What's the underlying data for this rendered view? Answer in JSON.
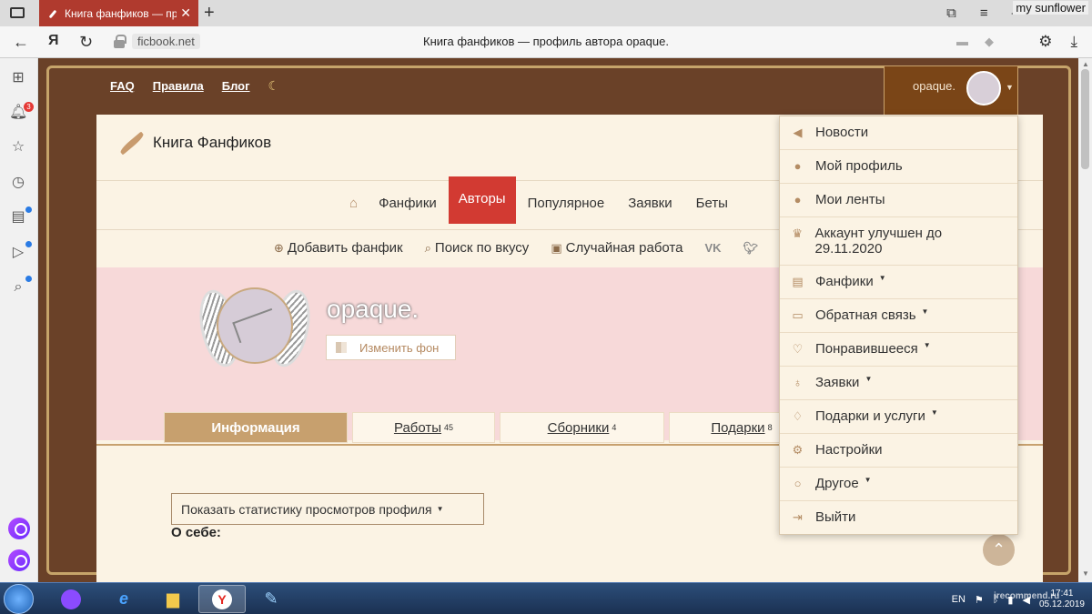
{
  "browser": {
    "tab_title": "Книга фанфиков — про",
    "url": "ficbook.net",
    "page_title": "Книга фанфиков — профиль автора opaque.",
    "yandex_logo": "Я",
    "watermark_user": "my sunflower",
    "notification_count": "3"
  },
  "site": {
    "top_links": [
      "FAQ",
      "Правила",
      "Блог"
    ],
    "username": "opaque.",
    "logo_text": "Книга Фанфиков",
    "main_nav": [
      "Фанфики",
      "Авторы",
      "Популярное",
      "Заявки",
      "Беты"
    ],
    "actions": [
      "Добавить фанфик",
      "Поиск по вкусу",
      "Случайная работа"
    ],
    "social": [
      "VK",
      "TW"
    ],
    "profile_name": "opaque.",
    "change_bg": "Изменить фон",
    "tabs": [
      {
        "label": "Информация",
        "count": ""
      },
      {
        "label": "Работы",
        "count": "45"
      },
      {
        "label": "Сборники",
        "count": "4"
      },
      {
        "label": "Подарки",
        "count": "8"
      }
    ],
    "stats_button": "Показать статистику просмотров профиля",
    "about_heading": "О себе:"
  },
  "dropdown": {
    "items": [
      {
        "label": "Новости",
        "icon": "megaphone-icon"
      },
      {
        "label": "Мой профиль",
        "icon": "user-icon"
      },
      {
        "label": "Мои ленты",
        "icon": "user-icon"
      },
      {
        "label": "Аккаунт улучшен до 29.11.2020",
        "icon": "crown-icon"
      },
      {
        "label": "Фанфики",
        "icon": "book-icon",
        "caret": true
      },
      {
        "label": "Обратная связь",
        "icon": "chat-icon",
        "caret": true
      },
      {
        "label": "Понравившееся",
        "icon": "heart-icon",
        "caret": true
      },
      {
        "label": "Заявки",
        "icon": "bulb-icon",
        "caret": true
      },
      {
        "label": "Подарки и услуги",
        "icon": "gift-icon",
        "caret": true
      },
      {
        "label": "Настройки",
        "icon": "gear-icon"
      },
      {
        "label": "Другое",
        "icon": "circle-icon",
        "caret": true
      },
      {
        "label": "Выйти",
        "icon": "exit-icon"
      }
    ]
  },
  "taskbar": {
    "lang": "EN",
    "time": "17:41",
    "date": "05.12.2019",
    "watermark": "irecommend.ru"
  },
  "colors": {
    "accent": "#d23a32",
    "tab_active": "#c7a06e",
    "cover": "#f7d9d9",
    "paper": "#fbf3e4"
  }
}
